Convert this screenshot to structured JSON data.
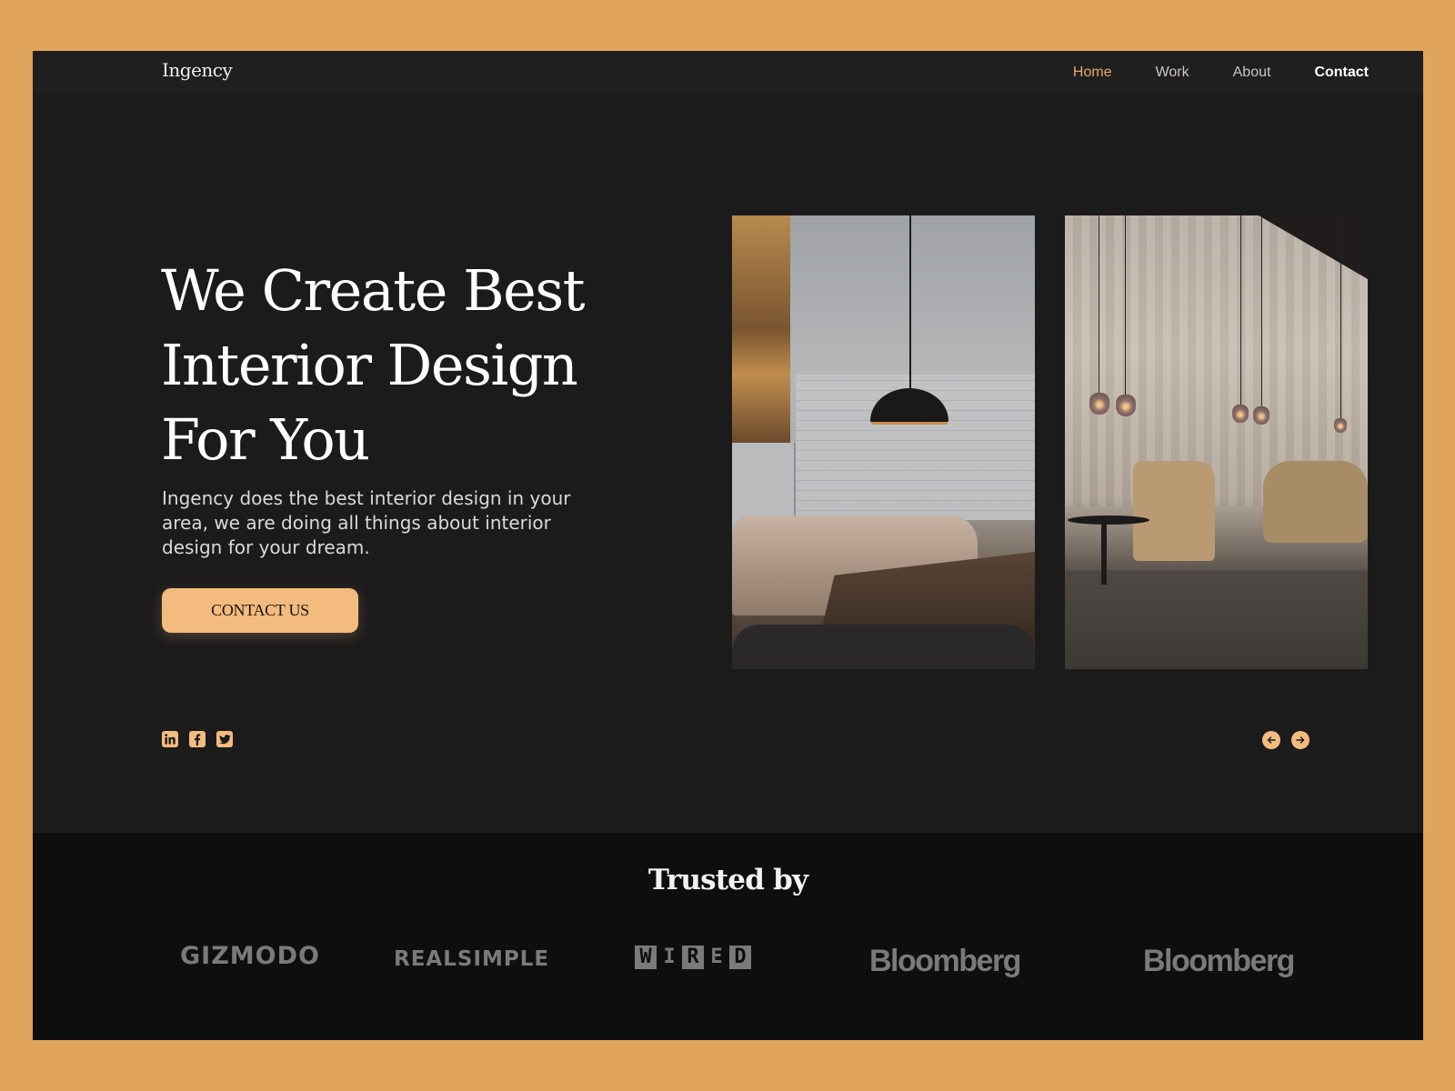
{
  "colors": {
    "page_background": "#e0a45c",
    "frame_background": "#1c1b1b",
    "nav_background": "#201f20",
    "accent": "#f3bb7e",
    "nav_active": "#e8a866",
    "trusted_background": "#0e0e0e",
    "brand_logo_gray": "#7a7a7a"
  },
  "nav": {
    "logo": "Ingency",
    "links": [
      {
        "label": "Home",
        "state": "active"
      },
      {
        "label": "Work",
        "state": "default"
      },
      {
        "label": "About",
        "state": "default"
      },
      {
        "label": "Contact",
        "state": "emphasized"
      }
    ]
  },
  "hero": {
    "title_lines": [
      "We Create Best",
      "Interior Design",
      "For You"
    ],
    "description": "Ingency does the best interior design in your area, we are doing  all things about interior design for your dream.",
    "cta_label": "CONTACT US",
    "socials": [
      {
        "name": "linkedin",
        "glyph": "in"
      },
      {
        "name": "facebook",
        "glyph": "f"
      },
      {
        "name": "twitter",
        "glyph": "t"
      }
    ],
    "carousel": {
      "prev_icon": "arrow-left-icon",
      "next_icon": "arrow-right-icon"
    },
    "images": [
      {
        "name": "lounge-with-pendant-lamp-photo",
        "description": "Interior with tufted sofa, wooden table, black pendant lamp and bottle shelves"
      },
      {
        "name": "curtain-lounge-photo",
        "description": "Lounge with curtains, hanging glass bulbs, beige armchairs and side tables"
      }
    ]
  },
  "trusted": {
    "title": "Trusted by",
    "brands": [
      "GIZMODO",
      "REALSIMPLE",
      "WIRED",
      "Bloomberg",
      "Bloomberg"
    ],
    "wired_letters": [
      {
        "ch": "W",
        "boxed": true
      },
      {
        "ch": "I",
        "boxed": false
      },
      {
        "ch": "R",
        "boxed": true
      },
      {
        "ch": "E",
        "boxed": false
      },
      {
        "ch": "D",
        "boxed": true
      }
    ]
  }
}
